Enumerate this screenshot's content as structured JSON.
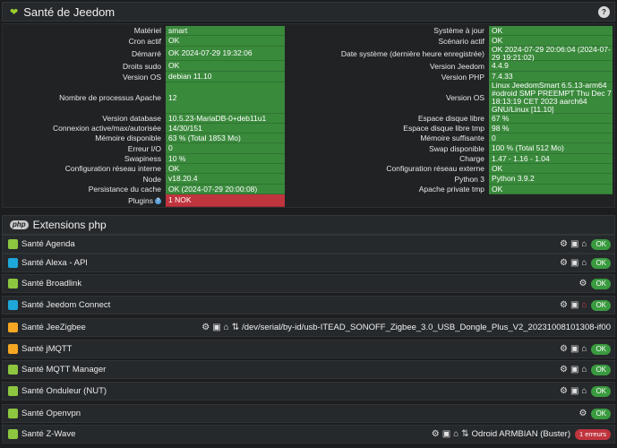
{
  "header": {
    "title": "Santé de Jeedom",
    "help_icon": "?"
  },
  "health": {
    "left": [
      {
        "label": "Matériel",
        "value": "smart"
      },
      {
        "label": "Cron actif",
        "value": "OK"
      },
      {
        "label": "Démarré",
        "value": "OK 2024-07-29 19:32:06"
      },
      {
        "label": "Droits sudo",
        "value": "OK"
      },
      {
        "label": "Version OS",
        "value": "debian 11.10"
      },
      {
        "label": "Nombre de processus Apache",
        "value": "12"
      },
      {
        "label": "Version database",
        "value": "10.5.23-MariaDB-0+deb11u1"
      },
      {
        "label": "Connexion active/max/autorisée",
        "value": "14/30/151"
      },
      {
        "label": "Mémoire disponible",
        "value": "63 % (Total 1853 Mo)"
      },
      {
        "label": "Erreur I/O",
        "value": "0"
      },
      {
        "label": "Swapiness",
        "value": "10 %"
      },
      {
        "label": "Configuration réseau interne",
        "value": "OK"
      },
      {
        "label": "Node",
        "value": "v18.20.4"
      },
      {
        "label": "Persistance du cache",
        "value": "OK (2024-07-29 20:00:08)"
      },
      {
        "label": "Plugins",
        "value": "1 NOK"
      }
    ],
    "right": [
      {
        "label": "Système à jour",
        "value": "OK"
      },
      {
        "label": "Scénario actif",
        "value": "OK"
      },
      {
        "label": "Date système (dernière heure enregistrée)",
        "value": "OK 2024-07-29 20:06:04 (2024-07-29 19:21:02)"
      },
      {
        "label": "Version Jeedom",
        "value": "4.4.9"
      },
      {
        "label": "Version PHP",
        "value": "7.4.33"
      },
      {
        "label": "Version OS",
        "value": "Linux JeedomSmart 6.5.13-arm64 #odroid SMP PREEMPT Thu Dec 7 18:13:19 CET 2023 aarch64 GNU/Linux [11.10]"
      },
      {
        "label": "Espace disque libre",
        "value": "67 %"
      },
      {
        "label": "Espace disque libre tmp",
        "value": "98 %"
      },
      {
        "label": "Mémoire suffisante",
        "value": "0"
      },
      {
        "label": "Swap disponible",
        "value": "100 % (Total 512 Mo)"
      },
      {
        "label": "Charge",
        "value": "1.47 - 1.16 - 1.04"
      },
      {
        "label": "Configuration réseau externe",
        "value": "OK"
      },
      {
        "label": "Python 3",
        "value": "Python 3.9.2"
      },
      {
        "label": "Apache private tmp",
        "value": "OK"
      }
    ]
  },
  "extensions": {
    "title": "Extensions php",
    "badge": "php"
  },
  "plugins": [
    {
      "label": "Santé Agenda",
      "icon_color": "#8dc63f",
      "status": "OK",
      "actions": [
        "cogs-icon",
        "camera-icon",
        "bank-icon"
      ]
    },
    {
      "label": "Santé Alexa - API",
      "icon_color": "#1ea7d9",
      "status": "OK",
      "actions": [
        "cogs-icon",
        "camera-icon",
        "bank-icon"
      ]
    },
    {
      "label": "Santé Broadlink",
      "icon_color": "#8dc63f",
      "status": "OK",
      "actions": [
        "cogs-icon"
      ]
    },
    {
      "label": "Santé Jeedom Connect",
      "icon_color": "#1ea7d9",
      "status": "OK",
      "actions": [
        "cogs-icon",
        "camera-icon",
        "bank-icon-red"
      ]
    },
    {
      "label": "Santé JeeZigbee",
      "icon_color": "#f5a623",
      "status": "",
      "info": "/dev/serial/by-id/usb-ITEAD_SONOFF_Zigbee_3.0_USB_Dongle_Plus_V2_20231008101308-if00",
      "actions": [
        "cogs-icon",
        "camera-icon",
        "bank-icon",
        "arrows-icon"
      ]
    },
    {
      "label": "Santé jMQTT",
      "icon_color": "#f5a623",
      "status": "OK",
      "actions": [
        "cogs-icon",
        "camera-icon",
        "bank-icon"
      ]
    },
    {
      "label": "Santé MQTT Manager",
      "icon_color": "#8dc63f",
      "status": "OK",
      "actions": [
        "cogs-icon",
        "camera-icon",
        "bank-icon"
      ]
    },
    {
      "label": "Santé Onduleur (NUT)",
      "icon_color": "#8dc63f",
      "status": "OK",
      "actions": [
        "cogs-icon",
        "camera-icon",
        "bank-icon"
      ]
    },
    {
      "label": "Santé Openvpn",
      "icon_color": "#8dc63f",
      "status": "OK",
      "actions": [
        "cogs-icon"
      ]
    },
    {
      "label": "Santé Z-Wave",
      "icon_color": "#8dc63f",
      "status": "",
      "info": "Odroid ARMBIAN (Buster)",
      "error": "1 erreurs",
      "actions": [
        "cogs-icon",
        "camera-icon",
        "bank-icon",
        "arrows-icon"
      ]
    }
  ]
}
